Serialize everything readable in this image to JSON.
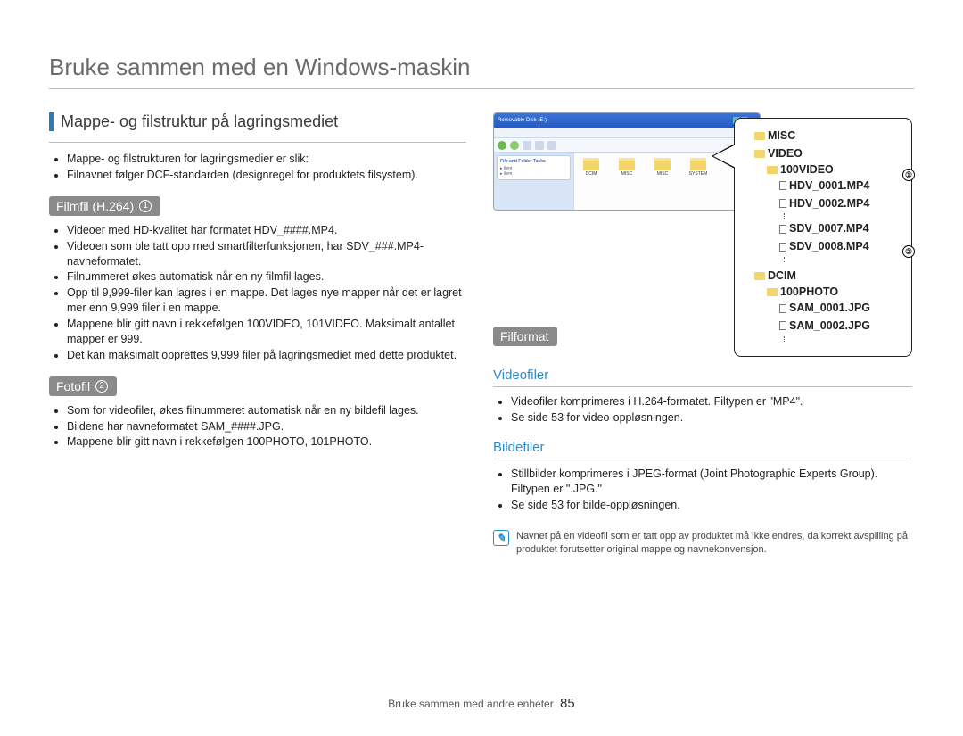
{
  "page_title": "Bruke sammen med en Windows-maskin",
  "section_title": "Mappe- og filstruktur på lagringsmediet",
  "intro_bullets": [
    "Mappe- og filstrukturen for lagringsmedier er slik:",
    "Filnavnet følger DCF-standarden (designregel for produktets filsystem)."
  ],
  "pill1": {
    "label": "Filmfil (H.264)",
    "num": "1"
  },
  "film_bullets": [
    "Videoer med HD-kvalitet har formatet HDV_####.MP4.",
    "Videoen som ble tatt opp med smartfilterfunksjonen, har SDV_###.MP4-navneformatet.",
    "Filnummeret økes automatisk når en ny filmfil lages.",
    "Opp til 9,999-filer kan lagres i en mappe. Det lages nye mapper når det er lagret mer enn 9,999 filer i en mappe.",
    "Mappene blir gitt navn i rekkefølgen 100VIDEO, 101VIDEO. Maksimalt antallet mapper er 999.",
    "Det kan maksimalt opprettes 9,999 filer på lagringsmediet med dette produktet."
  ],
  "pill2": {
    "label": "Fotofil",
    "num": "2"
  },
  "foto_bullets": [
    "Som for videofiler, økes filnummeret automatisk når en ny bildefil lages.",
    "Bildene har navneformatet SAM_####.JPG.",
    "Mappene blir gitt navn i rekkefølgen 100PHOTO, 101PHOTO."
  ],
  "pill3": {
    "label": "Filformat"
  },
  "sub_video": "Videofiler",
  "video_bullets": [
    "Videofiler komprimeres i H.264-formatet. Filtypen er \"MP4\".",
    "Se side 53 for video-oppløsningen."
  ],
  "sub_image": "Bildefiler",
  "image_bullets": [
    "Stillbilder komprimeres i JPEG-format (Joint Photographic Experts Group). Filtypen er \".JPG.\"",
    "Se side 53 for bilde-oppløsningen."
  ],
  "note_text": "Navnet på en videofil som er tatt opp av produktet må ikke endres, da korrekt avspilling på produktet forutsetter original mappe og navnekonvensjon.",
  "footer": {
    "chapter": "Bruke sammen med andre enheter",
    "page": "85"
  },
  "explorer": {
    "title": "Removable Disk (E:)",
    "panel_head": "File and Folder Tasks",
    "folders": [
      "DCIM",
      "MISC",
      "MISC",
      "SYSTEM"
    ]
  },
  "tree": {
    "misc": "MISC",
    "video": "VIDEO",
    "video_sub": "100VIDEO",
    "video_files": [
      "HDV_0001.MP4",
      "HDV_0002.MP4",
      "SDV_0007.MP4",
      "SDV_0008.MP4"
    ],
    "dcim": "DCIM",
    "dcim_sub": "100PHOTO",
    "dcim_files": [
      "SAM_0001.JPG",
      "SAM_0002.JPG"
    ],
    "call1": "①",
    "call2": "②"
  }
}
